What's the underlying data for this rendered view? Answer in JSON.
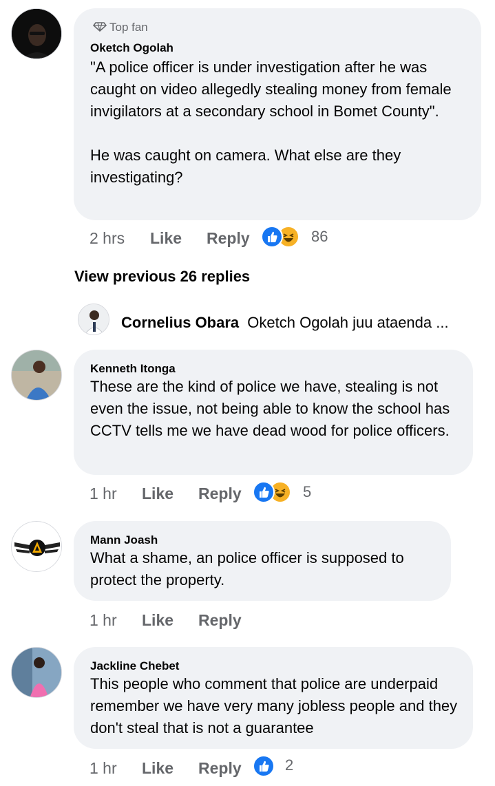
{
  "comments": [
    {
      "badge": "Top fan",
      "author": "Oketch Ogolah",
      "text": "\"A police officer is under investigation after he was caught on video allegedly stealing money from female invigilators at a secondary school in Bomet County\".\n\nHe was caught on camera. What else are they investigating?",
      "time": "2 hrs",
      "like": "Like",
      "reply": "Reply",
      "reaction_count": "86",
      "reactions": [
        "like",
        "haha"
      ]
    },
    {
      "author": "Kenneth Itonga",
      "text": "These are the kind of police we have, stealing is not even the issue, not being able to know the school has CCTV tells me we have dead wood for police officers.",
      "time": "1 hr",
      "like": "Like",
      "reply": "Reply",
      "reaction_count": "5",
      "reactions": [
        "like",
        "haha"
      ]
    },
    {
      "author": "Mann Joash",
      "text": "What a shame, an police officer is supposed to protect the property.",
      "time": "1 hr",
      "like": "Like",
      "reply": "Reply"
    },
    {
      "author": "Jackline Chebet",
      "text": "This people who comment that police are underpaid remember we have very many jobless people and they don't steal that is not a guarantee",
      "time": "1 hr",
      "like": "Like",
      "reply": "Reply",
      "reaction_count": "2",
      "reactions": [
        "like"
      ]
    }
  ],
  "replies_thread": {
    "view_previous": "View previous 26 replies",
    "preview_author": "Cornelius Obara",
    "preview_text": "Oketch Ogolah juu ataenda ..."
  },
  "colors": {
    "bubble": "#f0f2f5",
    "meta_text": "#65676b",
    "like_blue": "#1877f2",
    "haha_yellow": "#f7b125"
  },
  "icons": {
    "badge": "diamond-icon",
    "like_reaction": "thumbs-up-icon",
    "haha_reaction": "laughing-face-icon"
  }
}
